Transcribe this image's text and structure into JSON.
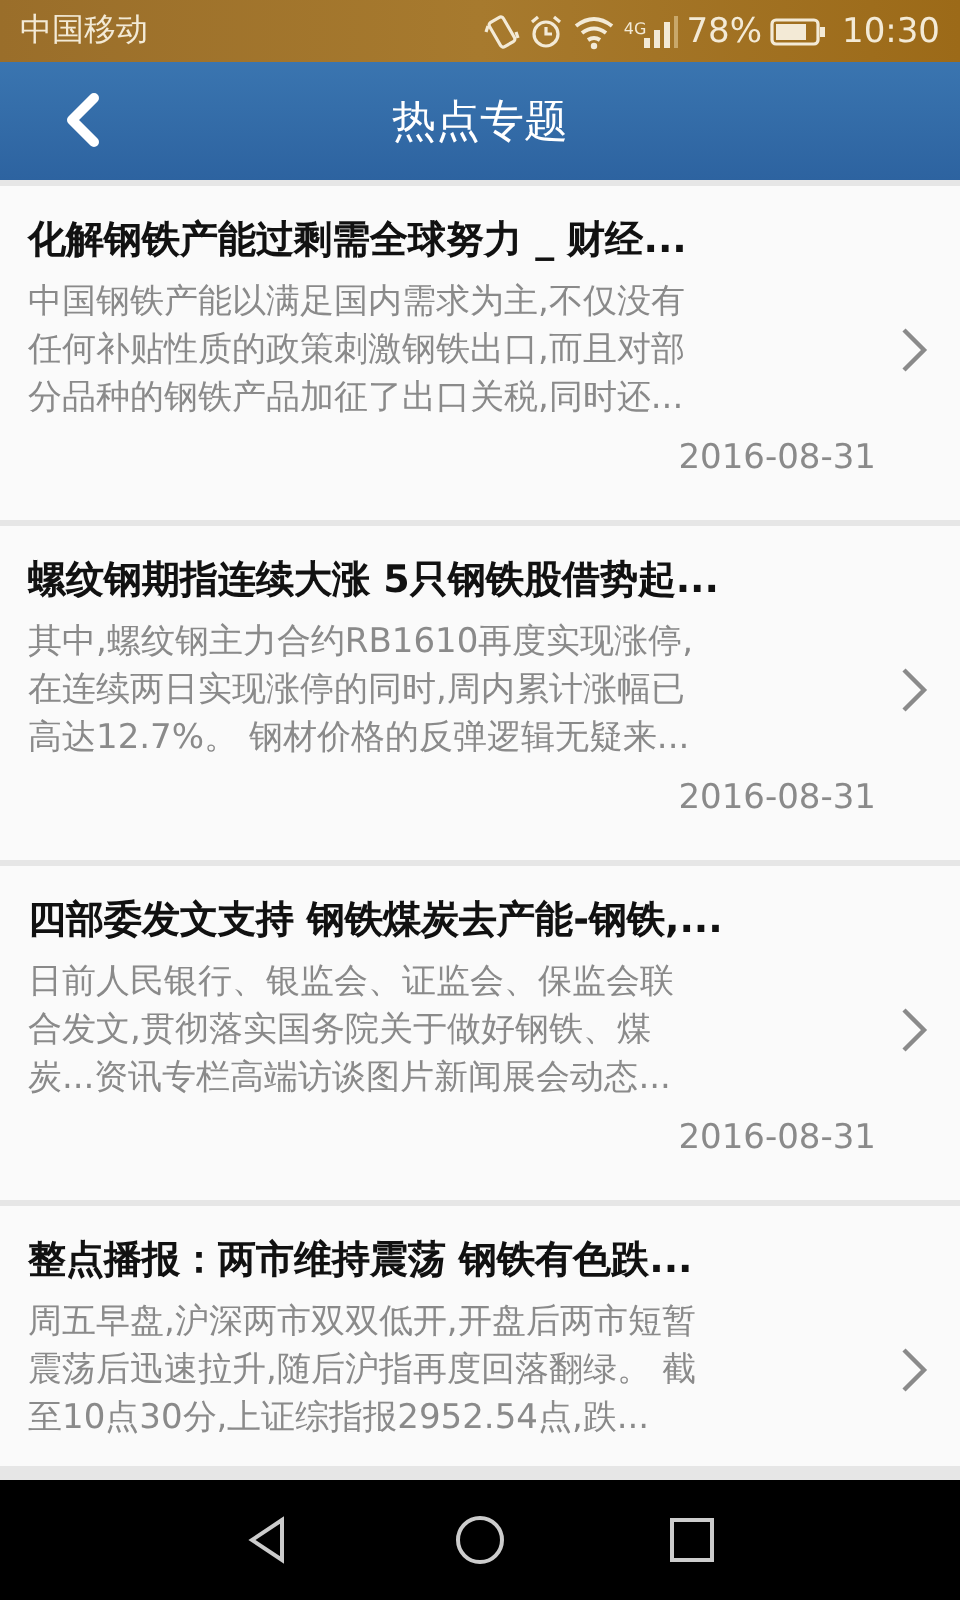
{
  "status_bar": {
    "carrier": "中国移动",
    "network": "4G",
    "battery": "78%",
    "time": "10:30"
  },
  "header": {
    "title": "热点专题"
  },
  "articles": [
    {
      "title": "化解钢铁产能过剩需全球努力 _ 财经...",
      "summary_lines": [
        "中国钢铁产能以满足国内需求为主,不仅没有",
        "任何补贴性质的政策刺激钢铁出口,而且对部",
        "分品种的钢铁产品加征了出口关税,同时还..."
      ],
      "date": "2016-08-31"
    },
    {
      "title": "螺纹钢期指连续大涨 5只钢铁股借势起...",
      "summary_lines": [
        "其中,螺纹钢主力合约RB1610再度实现涨停,",
        "在连续两日实现涨停的同时,周内累计涨幅已",
        "高达12.7%。 钢材价格的反弹逻辑无疑来..."
      ],
      "date": "2016-08-31"
    },
    {
      "title": "四部委发文支持 钢铁煤炭去产能-钢铁,...",
      "summary_lines": [
        "日前人民银行、银监会、证监会、保监会联",
        "合发文,贯彻落实国务院关于做好钢铁、煤",
        "炭...资讯专栏高端访谈图片新闻展会动态..."
      ],
      "date": "2016-08-31"
    },
    {
      "title": "整点播报：两市维持震荡 钢铁有色跌...",
      "summary_lines": [
        "周五早盘,沪深两市双双低开,开盘后两市短暂",
        "震荡后迅速拉升,随后沪指再度回落翻绿。 截",
        "至10点30分,上证综指报2952.54点,跌..."
      ]
    }
  ]
}
